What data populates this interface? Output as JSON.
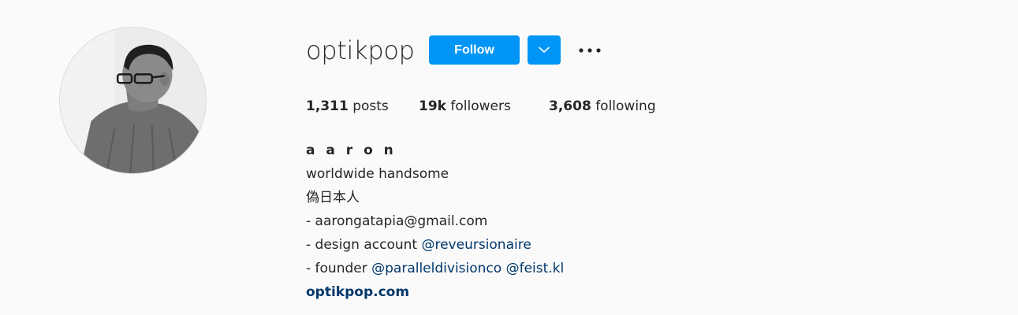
{
  "profile": {
    "username": "optikpop",
    "follow_label": "Follow",
    "icons": {
      "dropdown": "chevron-down-icon",
      "more": "more-options-icon"
    },
    "stats": {
      "posts_count": "1,311",
      "posts_label": "posts",
      "followers_count": "19k",
      "followers_label": "followers",
      "following_count": "3,608",
      "following_label": "following"
    },
    "bio": {
      "name": "a a r o n",
      "line1": "worldwide handsome",
      "line2": "偽日本人",
      "line3": "- aarongatapia@gmail.com",
      "line4_prefix": "- design account ",
      "line4_mention": "@reveursionaire",
      "line5_prefix": "- founder ",
      "line5_mention1": "@paralleldivisionco",
      "line5_mention2": "@feist.kl",
      "website": "optikpop.com"
    }
  },
  "colors": {
    "background": "#fafafa",
    "primary_button": "#0095f6",
    "link": "#00376b",
    "text": "#262626"
  }
}
